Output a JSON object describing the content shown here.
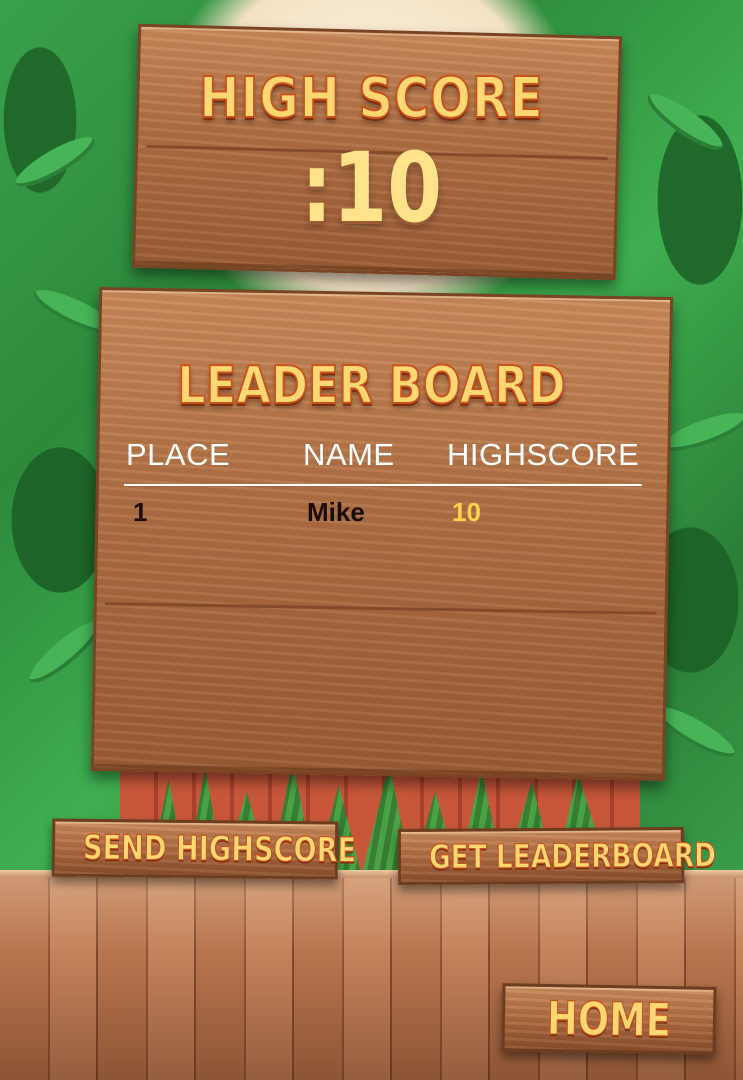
{
  "high_score": {
    "label": "HIGH SCORE",
    "value": ":10"
  },
  "leaderboard": {
    "title": "LEADER BOARD",
    "columns": [
      "PLACE",
      "NAME",
      "HIGHSCORE"
    ],
    "rows": [
      {
        "place": "1",
        "name": "Mike",
        "score": "10"
      }
    ]
  },
  "buttons": {
    "send_highscore": "SEND HIGHSCORE",
    "get_leaderboard": "GET LEADERBOARD",
    "home": "HOME"
  },
  "colors": {
    "title_fill": "#ffd873",
    "title_outline": "#c9521e",
    "wood": "#b06f43",
    "score_highlight": "#ffd24a",
    "foliage": "#2f8a3a"
  }
}
